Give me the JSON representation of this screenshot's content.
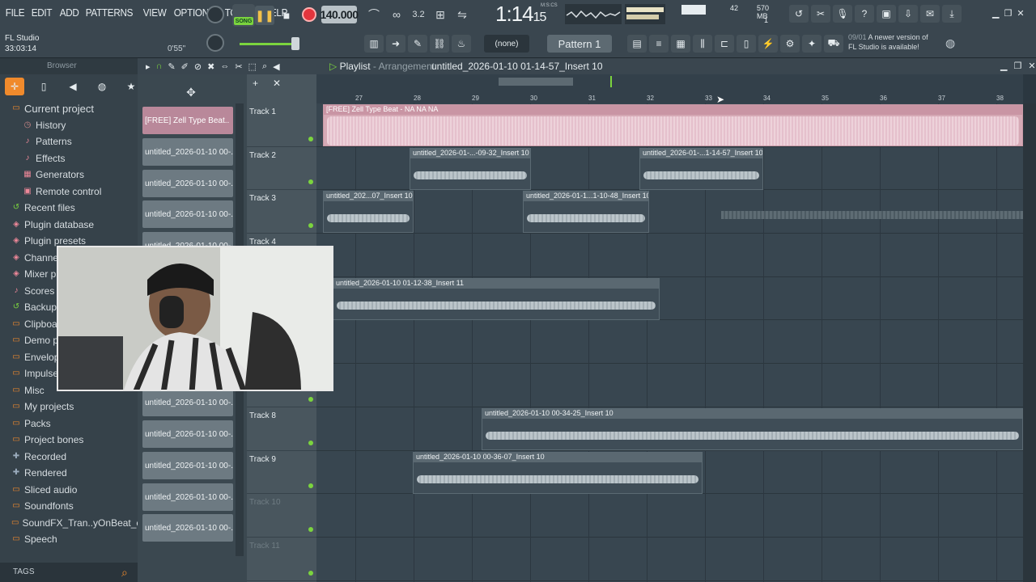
{
  "menu": [
    "FILE",
    "EDIT",
    "ADD",
    "PATTERNS",
    "VIEW",
    "OPTIONS",
    "TOOLS",
    "HELP"
  ],
  "transport": {
    "song_label": "SONG",
    "tempo": "140.000",
    "time_main": "1:14",
    "time_sub": "15",
    "time_unit": "M:S:CS"
  },
  "status": {
    "cpu_value": "42",
    "ram": "570 MB",
    "poly": "1"
  },
  "hint": {
    "date": "09/01",
    "line1": "A newer version of",
    "line2": "FL Studio is available!"
  },
  "song": {
    "app": "FL Studio",
    "position": "33:03:14",
    "length": "0'55\""
  },
  "pattern": {
    "selector": "(none)",
    "name": "Pattern 1"
  },
  "browser": {
    "title": "Browser",
    "items": [
      {
        "label": "Current project",
        "icon": "folder-icon"
      },
      {
        "label": "History",
        "icon": "history-icon"
      },
      {
        "label": "Patterns",
        "icon": "patterns-icon"
      },
      {
        "label": "Effects",
        "icon": "effects-icon"
      },
      {
        "label": "Generators",
        "icon": "generators-icon"
      },
      {
        "label": "Remote control",
        "icon": "remote-icon"
      },
      {
        "label": "Recent files",
        "icon": "recent-icon"
      },
      {
        "label": "Plugin database",
        "icon": "plugin-icon"
      },
      {
        "label": "Plugin presets",
        "icon": "preset-icon"
      },
      {
        "label": "Channel presets",
        "icon": "channel-icon"
      },
      {
        "label": "Mixer presets",
        "icon": "mixer-icon"
      },
      {
        "label": "Scores",
        "icon": "scores-icon"
      },
      {
        "label": "Backup",
        "icon": "backup-icon"
      },
      {
        "label": "Clipboard files",
        "icon": "folder-icon"
      },
      {
        "label": "Demo projects",
        "icon": "folder-icon"
      },
      {
        "label": "Envelopes",
        "icon": "folder-icon"
      },
      {
        "label": "Impulses",
        "icon": "folder-icon"
      },
      {
        "label": "Misc",
        "icon": "folder-icon"
      },
      {
        "label": "My projects",
        "icon": "folder-icon"
      },
      {
        "label": "Packs",
        "icon": "folder-icon"
      },
      {
        "label": "Project bones",
        "icon": "folder-icon"
      },
      {
        "label": "Recorded",
        "icon": "recorded-icon"
      },
      {
        "label": "Rendered",
        "icon": "rendered-icon"
      },
      {
        "label": "Sliced audio",
        "icon": "folder-icon"
      },
      {
        "label": "Soundfonts",
        "icon": "folder-icon"
      },
      {
        "label": "SoundFX_Tran..yOnBeat_com",
        "icon": "folder-icon"
      },
      {
        "label": "Speech",
        "icon": "folder-icon"
      }
    ],
    "tags": "TAGS"
  },
  "channels": [
    "[FREE] Zell Type Beat..",
    "untitled_2026-01-10 00-..",
    "untitled_2026-01-10 00-..",
    "untitled_2026-01-10 00-..",
    "untitled_2026-01-10 00-..",
    "untitled_2026-01-10 00-..",
    "untitled_2026-01-10 00-..",
    "untitled_2026-01-10 00-..",
    "untitled_2026-01-10 00-..",
    "untitled_2026-01-10 00-..",
    "untitled_2026-01-10 00-..",
    "untitled_2026-01-10 00-..",
    "untitled_2026-01-10 00-..",
    "untitled_2026-01-10 00-.."
  ],
  "playlist": {
    "title": "Playlist",
    "sub": "Arrangement",
    "file": "untitled_2026-01-10 01-14-57_Insert 10",
    "bars": [
      "27",
      "28",
      "29",
      "30",
      "31",
      "32",
      "33",
      "34",
      "35",
      "36",
      "37",
      "38"
    ],
    "tracks": [
      "Track 1",
      "Track 2",
      "Track 3",
      "Track 4",
      "",
      "",
      "",
      "Track 8",
      "Track 9",
      "Track 10",
      "Track 11"
    ],
    "clips": [
      {
        "label": "[FREE] Zell Type Beat - NA NA NA"
      },
      {
        "label": "untitled_2026-01-...-09-32_Insert 10"
      },
      {
        "label": "untitled_2026-01-...1-14-57_Insert 10"
      },
      {
        "label": "untitled_202...07_Insert 10"
      },
      {
        "label": "untitled_2026-01-1...1-10-48_Insert 10"
      },
      {
        "label": "untitled_2026-01-10 01-12-38_Insert 11"
      },
      {
        "label": "untitled_2026-01-10 00-34-25_Insert 10"
      },
      {
        "label": "untitled_2026-01-10 00-36-07_Insert 10"
      }
    ]
  }
}
